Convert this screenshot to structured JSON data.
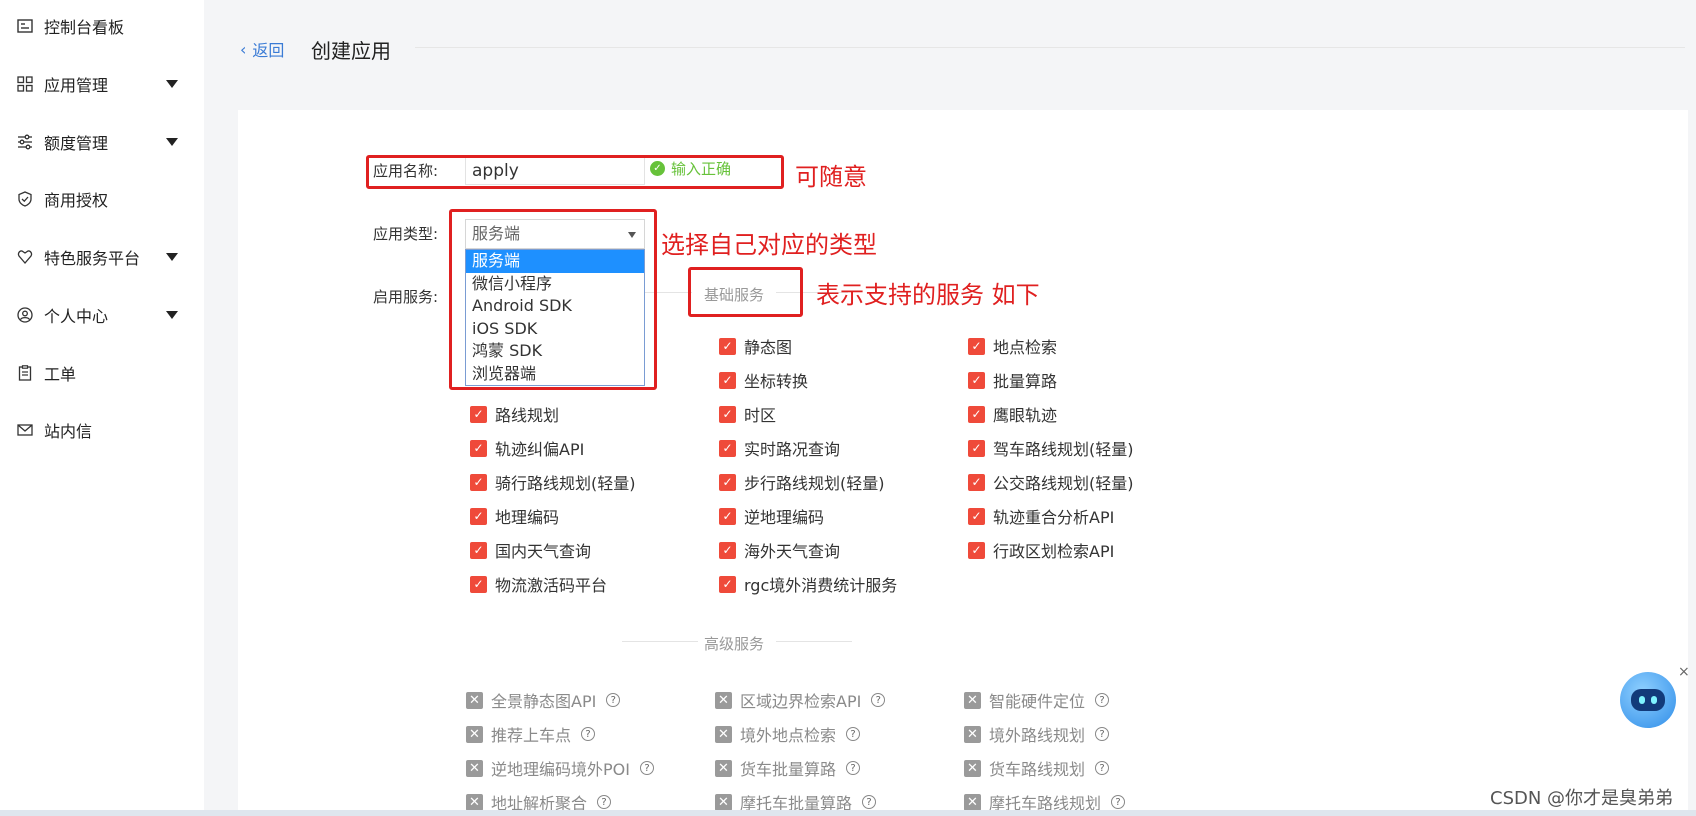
{
  "sidebar": {
    "items": [
      {
        "label": "控制台看板",
        "icon": "dashboard-icon",
        "has_caret": false
      },
      {
        "label": "应用管理",
        "icon": "grid-icon",
        "has_caret": true
      },
      {
        "label": "额度管理",
        "icon": "sliders-icon",
        "has_caret": true
      },
      {
        "label": "商用授权",
        "icon": "shield-icon",
        "has_caret": false
      },
      {
        "label": "特色服务平台",
        "icon": "heart-shield-icon",
        "has_caret": true
      },
      {
        "label": "个人中心",
        "icon": "user-icon",
        "has_caret": true
      },
      {
        "label": "工单",
        "icon": "clipboard-icon",
        "has_caret": false
      },
      {
        "label": "站内信",
        "icon": "mail-icon",
        "has_caret": false
      }
    ]
  },
  "header": {
    "back_label": "返回",
    "title": "创建应用"
  },
  "form": {
    "name_label": "应用名称:",
    "name_value": "apply",
    "name_valid_msg": "输入正确",
    "type_label": "应用类型:",
    "type_selected": "服务端",
    "type_options": [
      "服务端",
      "微信小程序",
      "Android SDK",
      "iOS SDK",
      "鸿蒙 SDK",
      "浏览器端"
    ],
    "services_label": "启用服务:"
  },
  "basic_services": {
    "title": "基础服务",
    "items": [
      "",
      "静态图",
      "地点检索",
      "",
      "坐标转换",
      "批量算路",
      "路线规划",
      "时区",
      "鹰眼轨迹",
      "轨迹纠偏API",
      "实时路况查询",
      "驾车路线规划(轻量)",
      "骑行路线规划(轻量)",
      "步行路线规划(轻量)",
      "公交路线规划(轻量)",
      "地理编码",
      "逆地理编码",
      "轨迹重合分析API",
      "国内天气查询",
      "海外天气查询",
      "行政区划检索API",
      "物流激活码平台",
      "rgc境外消费统计服务",
      ""
    ]
  },
  "advanced_services": {
    "title": "高级服务",
    "items": [
      "全景静态图API",
      "区域边界检索API",
      "智能硬件定位",
      "推荐上车点",
      "境外地点检索",
      "境外路线规划",
      "逆地理编码境外POI",
      "货车批量算路",
      "货车路线规划",
      "地址解析聚合",
      "摩托车批量算路",
      "摩托车路线规划"
    ]
  },
  "annotations": {
    "name_note": "可随意",
    "type_note": "选择自己对应的类型",
    "services_note": "表示支持的服务 如下"
  },
  "watermark": "CSDN @你才是臭弟弟",
  "colors": {
    "accent": "#1e90ff",
    "check": "#ef4a3a",
    "valid": "#67c23a",
    "annotation": "#e02020"
  }
}
